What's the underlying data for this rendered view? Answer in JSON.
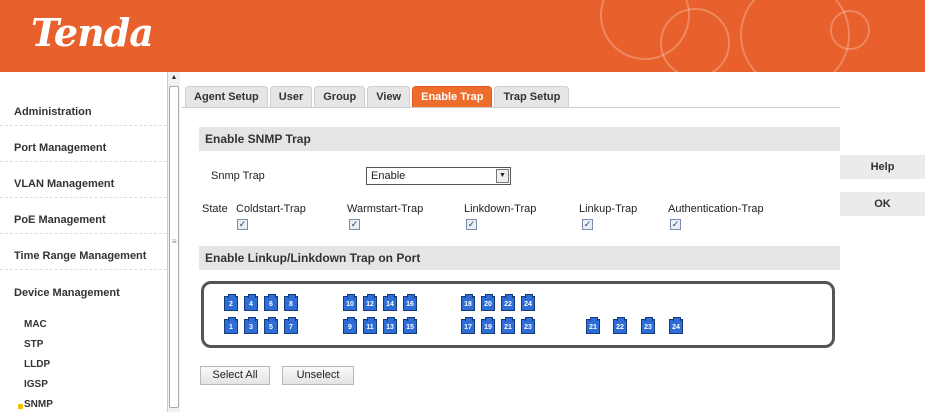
{
  "brand": {
    "logo": "Tenda",
    "accent": "#e8602b"
  },
  "sidebar": {
    "items": [
      {
        "label": "Administration"
      },
      {
        "label": "Port Management"
      },
      {
        "label": "VLAN Management"
      },
      {
        "label": "PoE Management"
      },
      {
        "label": "Time Range Management"
      },
      {
        "label": "Device Management"
      }
    ],
    "subitems": [
      {
        "label": "MAC"
      },
      {
        "label": "STP"
      },
      {
        "label": "LLDP"
      },
      {
        "label": "IGSP"
      },
      {
        "label": "SNMP",
        "active": true
      }
    ]
  },
  "tabs": [
    {
      "label": "Agent Setup"
    },
    {
      "label": "User"
    },
    {
      "label": "Group"
    },
    {
      "label": "View"
    },
    {
      "label": "Enable Trap",
      "active": true
    },
    {
      "label": "Trap Setup"
    }
  ],
  "section1": {
    "title": "Enable SNMP Trap",
    "snmp_trap_label": "Snmp Trap",
    "snmp_trap_value": "Enable",
    "state_label": "State",
    "traps": [
      {
        "label": "Coldstart-Trap",
        "checked": true
      },
      {
        "label": "Warmstart-Trap",
        "checked": true
      },
      {
        "label": "Linkdown-Trap",
        "checked": true
      },
      {
        "label": "Linkup-Trap",
        "checked": true
      },
      {
        "label": "Authentication-Trap",
        "checked": true
      }
    ]
  },
  "section2": {
    "title": "Enable Linkup/Linkdown Trap on Port",
    "top_ports": [
      "2",
      "4",
      "6",
      "8",
      "10",
      "12",
      "14",
      "16",
      "18",
      "20",
      "22",
      "24"
    ],
    "bottom_ports": [
      "1",
      "3",
      "5",
      "7",
      "9",
      "11",
      "13",
      "15",
      "17",
      "19",
      "21",
      "23"
    ],
    "uplink_ports": [
      "21",
      "22",
      "23",
      "24"
    ],
    "select_all": "Select All",
    "unselect": "Unselect"
  },
  "actions": {
    "help": "Help",
    "ok": "OK"
  }
}
